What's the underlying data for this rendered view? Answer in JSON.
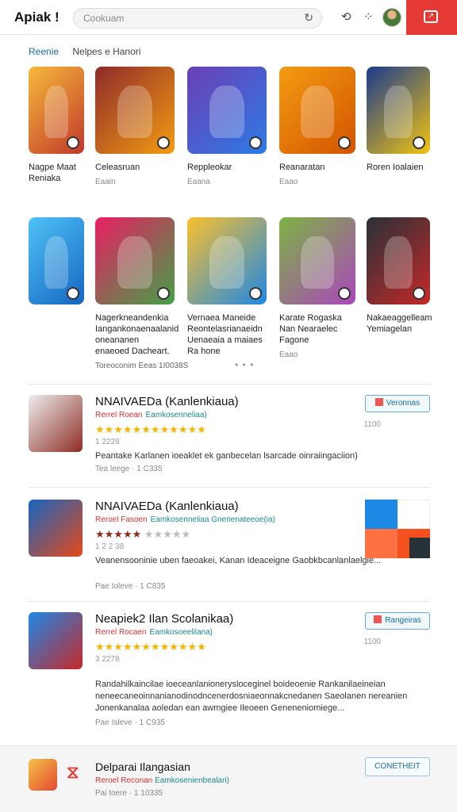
{
  "header": {
    "logo": "Apiak !",
    "search_placeholder": "Cookuam",
    "icons": [
      "refresh-icon",
      "share-icon",
      "expand-icon",
      "avatar",
      "window-icon"
    ],
    "accent": "#e53935"
  },
  "crumbs": {
    "active": "Reenie",
    "second": "Nelpes e Hanori"
  },
  "grid_row1": [
    {
      "name": "Nagpe Maat Reniaka",
      "meta": "",
      "colors": [
        "#f6b93b",
        "#c0392b"
      ]
    },
    {
      "name": "Celeasruan",
      "meta": "Eaain",
      "colors": [
        "#8e2b2b",
        "#f39c12"
      ]
    },
    {
      "name": "Reppleokar",
      "meta": "Eaana",
      "colors": [
        "#6c3fb5",
        "#2c7be5"
      ]
    },
    {
      "name": "Reanaratan",
      "meta": "Eaao",
      "colors": [
        "#f39c12",
        "#d35400"
      ]
    },
    {
      "name": "Roren Ioalaien",
      "meta": "",
      "colors": [
        "#1b3a8f",
        "#f1c40f"
      ]
    }
  ],
  "grid_row2": [
    {
      "name": "",
      "meta": "",
      "colors": [
        "#4fc3f7",
        "#1565c0"
      ]
    },
    {
      "name": "Nagerkneandenkia Iangankonaenaalanid oneananen enaeoed Dacheart.",
      "meta": "",
      "colors": [
        "#e91e63",
        "#43a047"
      ]
    },
    {
      "name": "Vernaea Maneide Reontelasrianaeidn Uenaeaia a maiaes Ra hone",
      "meta": "",
      "colors": [
        "#fbc02d",
        "#1e88e5"
      ]
    },
    {
      "name": "Karate Rogaska Nan Nearaelec Fagone",
      "meta": "Eaao",
      "colors": [
        "#7cb342",
        "#ab47bc"
      ]
    },
    {
      "name": "Nakaeaggelleam Yemiagelan",
      "meta": "",
      "colors": [
        "#263238",
        "#c62828"
      ]
    }
  ],
  "footnote": "Toreoconim Eeas 1I0038S",
  "dots": "• • •",
  "list": [
    {
      "title": "NNAIVAEDa (Kanlenkiaua)",
      "sub_red": "Rerrel Roean",
      "sub_teal": "Eamkosenneliaa)",
      "stars": "★★★★★★★★★★★★",
      "stars_grey": "",
      "rc": "1 2228",
      "desc": "Peantake Karlanen ioeaklet ek ganbecelan lsarcade oinraiingaciion)",
      "foot": "Tea leege · 1 C335",
      "pill": "Veronnas",
      "pill_count": "1100",
      "thumb_colors": [
        "#eeeeee",
        "#8d2d24"
      ]
    },
    {
      "title": "NNAIVAEDa (Kanlenkiaua)",
      "sub_red": "Reroel Fasoen",
      "sub_teal": "Eamkosenneliaa Gnenenateeoe(ia)",
      "stars": "★★★★★",
      "stars_grey": "★★★★★",
      "rc": "1 2 2 38",
      "desc": "Veanensooninie uben faeoakei, Kanan Ideaceigne Gaobkbcanlanlaelgie...",
      "foot": "Pae toleve · 1 C835",
      "pill": "",
      "pill_count": "",
      "thumb_colors": [
        "#1565c0",
        "#e64a19"
      ]
    },
    {
      "title": "Neapiek2 Ilan Scolanikaa)",
      "sub_red": "Rerrel Rocaen",
      "sub_teal": "Eamkosoeelilana)",
      "stars": "★★★★★★★★★★★★",
      "stars_grey": "",
      "rc": "3 2278",
      "desc": "Randahilkaincilae ioeceanlanionerysloceginel boideoenie Rankanilaeineian neneecaneoinnanianodinodncenerdosniaeonnakcnedanen Saeolanen nereanien Jonenkanalaa aoledan ean awmgiee Ileoeen Geneneniomiege...",
      "foot": "Pae Isleve · 1 C935",
      "pill": "Rangeiras",
      "pill_count": "1100",
      "thumb_colors": [
        "#1e88e5",
        "#c62828"
      ]
    }
  ],
  "bottom": {
    "title": "Delparai Ilangasian",
    "sub_red": "Reroel Reconan",
    "sub_teal": "Eamkosenienbealan)",
    "foot": "Pai toere · 1 10335",
    "button": "CONETHEIT"
  }
}
